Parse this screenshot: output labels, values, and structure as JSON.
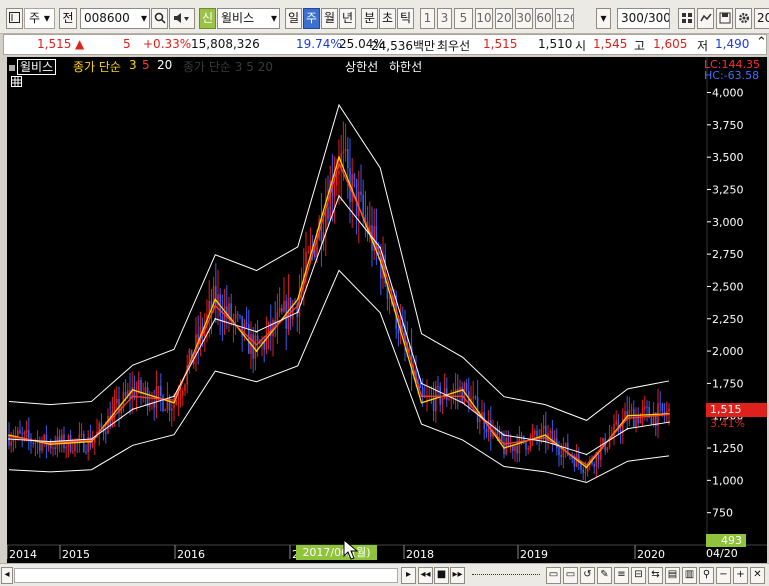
{
  "toolbar": {
    "market_label": "주",
    "prev_label": "전",
    "code_value": "008600",
    "alert_label": "신",
    "name_value": "윌비스",
    "periods": [
      "일",
      "주",
      "월",
      "년",
      "분",
      "초",
      "틱"
    ],
    "selected_period": "주",
    "counts": [
      "1",
      "3",
      "5",
      "10",
      "20",
      "30",
      "60",
      "120"
    ],
    "bars_value": "300/300",
    "right_edge_label": "20"
  },
  "info": {
    "price": "1,515",
    "change_arrow": "▲",
    "change": "5",
    "change_pct": "+0.33%",
    "volume": "15,808,326",
    "turnover_pct": "19.74%",
    "foreign_pct": "25.04%",
    "amount": "24,536백만",
    "best_ask_label": "최우선",
    "best_ask": "1,515",
    "best_bid": "1,510",
    "open_label": "시",
    "open": "1,545",
    "high_label": "고",
    "high": "1,605",
    "low_label": "저",
    "low": "1,490"
  },
  "legend": {
    "name": "윌비스",
    "ma_title": "종가 단순",
    "ma3": "3",
    "ma5": "5",
    "ma20": "20",
    "hidden": "종가 단순 3 5 20",
    "upper": "상한선",
    "lower": "하한선"
  },
  "price_box": {
    "value": "1,515",
    "pct": "3.41%"
  },
  "lc_label": "LC:144.35",
  "hc_label": "HC:-63.58",
  "volume_badge": "493",
  "date_badge": "2017/06/(월)",
  "last_date": "04/20",
  "colors": {
    "up": "#e0201b",
    "down": "#3a5cf0",
    "ma3": "#ffd400",
    "ma5": "#ff3b2f",
    "ma20": "#ffffff",
    "band": "#ffffff",
    "axis_text": "#ffffff",
    "badge": "#8fc43a"
  },
  "chart_data": {
    "type": "line",
    "title": "",
    "xlabel": "",
    "ylabel": "",
    "x": [
      "2014",
      "2015",
      "2016",
      "2017",
      "2018",
      "2019",
      "2020"
    ],
    "y_ticks": [
      750,
      1000,
      1250,
      1500,
      1750,
      2000,
      2250,
      2500,
      2750,
      3000,
      3250,
      3500,
      3750,
      4000
    ],
    "ylim": [
      500,
      4120
    ],
    "grid": false,
    "series": [
      {
        "name": "3",
        "values": [
          1350,
          1280,
          1300,
          1700,
          1600,
          2400,
          2000,
          2400,
          3500,
          2700,
          1600,
          1700,
          1250,
          1350,
          1100,
          1500,
          1515
        ]
      },
      {
        "name": "5",
        "values": [
          1340,
          1290,
          1310,
          1650,
          1620,
          2350,
          2050,
          2350,
          3450,
          2750,
          1650,
          1650,
          1280,
          1330,
          1120,
          1480,
          1510
        ]
      },
      {
        "name": "20",
        "values": [
          1320,
          1300,
          1320,
          1550,
          1650,
          2250,
          2150,
          2300,
          3200,
          2800,
          1750,
          1600,
          1350,
          1300,
          1200,
          1400,
          1450
        ]
      }
    ]
  }
}
